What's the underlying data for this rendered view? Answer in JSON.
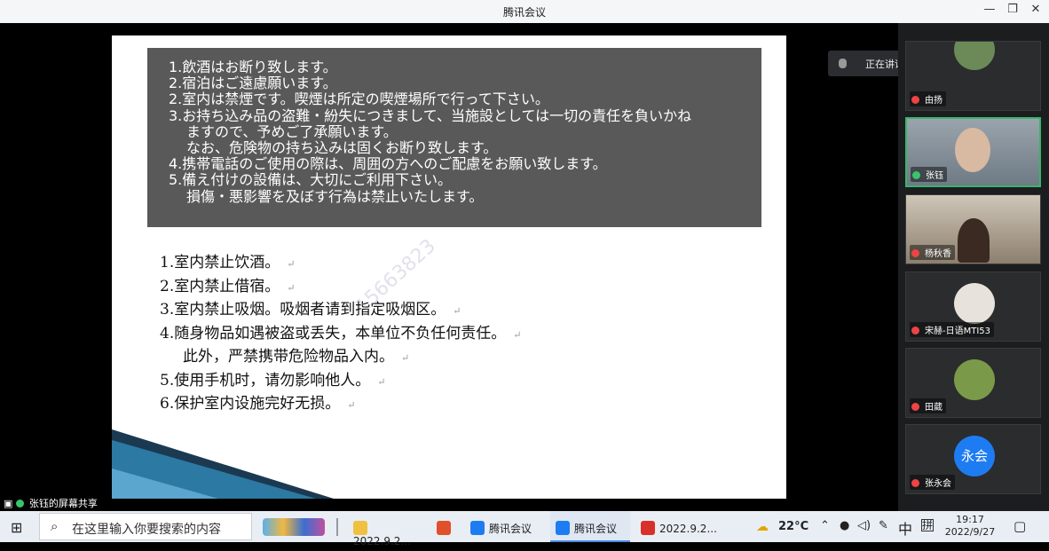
{
  "window": {
    "title": "腾讯会议",
    "minimize": "—",
    "restore": "❐",
    "close": "✕"
  },
  "slide": {
    "japanese_lines": [
      {
        "text": "1.飲酒はお断り致します。",
        "indent": false
      },
      {
        "text": "2.宿泊はご遠慮願います。",
        "indent": false
      },
      {
        "text": "2.室内は禁煙です。喫煙は所定の喫煙場所で行って下さい。",
        "indent": false
      },
      {
        "text": "3.お持ち込み品の盗難・紛失につきまして、当施設としては一切の責任を負いかね",
        "indent": false
      },
      {
        "text": "ますので、予めご了承願います。",
        "indent": true
      },
      {
        "text": "なお、危険物の持ち込みは固くお断り致します。",
        "indent": true
      },
      {
        "text": "4.携帯電話のご使用の際は、周囲の方へのご配慮をお願い致します。",
        "indent": false
      },
      {
        "text": "5.備え付けの設備は、大切にご利用下さい。",
        "indent": false
      },
      {
        "text": "損傷・悪影響を及ぼす行為は禁止いたします。",
        "indent": true
      }
    ],
    "chinese_lines": [
      {
        "text": "1.室内禁止饮酒。",
        "indent": false
      },
      {
        "text": "2.室内禁止借宿。",
        "indent": false
      },
      {
        "text": "3.室内禁止吸烟。吸烟者请到指定吸烟区。",
        "indent": false
      },
      {
        "text": "4.随身物品如遇被盗或丢失，本单位不负任何责任。",
        "indent": false
      },
      {
        "text": "此外，严禁携带危险物品入内。",
        "indent": true
      },
      {
        "text": "5.使用手机时，请勿影响他人。",
        "indent": false
      },
      {
        "text": "6.保护室内设施完好无损。",
        "indent": false
      }
    ],
    "paragraph_mark": "↵",
    "watermark": "15663823"
  },
  "speaking": {
    "label": "正在讲话: 张钰;"
  },
  "participants": [
    {
      "name": "由扬",
      "mic": "muted",
      "active": false
    },
    {
      "name": "张钰",
      "mic": "on",
      "active": true
    },
    {
      "name": "杨秋香",
      "mic": "muted",
      "active": false
    },
    {
      "name": "宋赫-日语MTI53",
      "mic": "muted",
      "active": false
    },
    {
      "name": "田葳",
      "mic": "muted",
      "active": false
    },
    {
      "name": "张永会",
      "mic": "muted",
      "active": false,
      "avatar_text": "永会"
    }
  ],
  "share_label": "张钰的屏幕共享",
  "taskbar": {
    "search_placeholder": "在这里输入你要搜索的内容",
    "apps": [
      {
        "label": "2022.9.2...",
        "icon": "folder-icon",
        "active": false
      },
      {
        "label": "",
        "icon": "office-icon",
        "active": false
      },
      {
        "label": "腾讯会议",
        "icon": "tencent-meeting-icon",
        "active": false
      },
      {
        "label": "腾讯会议",
        "icon": "tencent-meeting-icon",
        "active": true
      },
      {
        "label": "2022.9.2...",
        "icon": "wps-icon",
        "active": false
      }
    ],
    "weather": "22°C",
    "ime": "中",
    "time": "19:17",
    "date": "2022/9/27"
  },
  "colors": {
    "jp_box": "#595959",
    "active_tile": "#39b56d",
    "avatar_blue": "#1e7cf2"
  }
}
